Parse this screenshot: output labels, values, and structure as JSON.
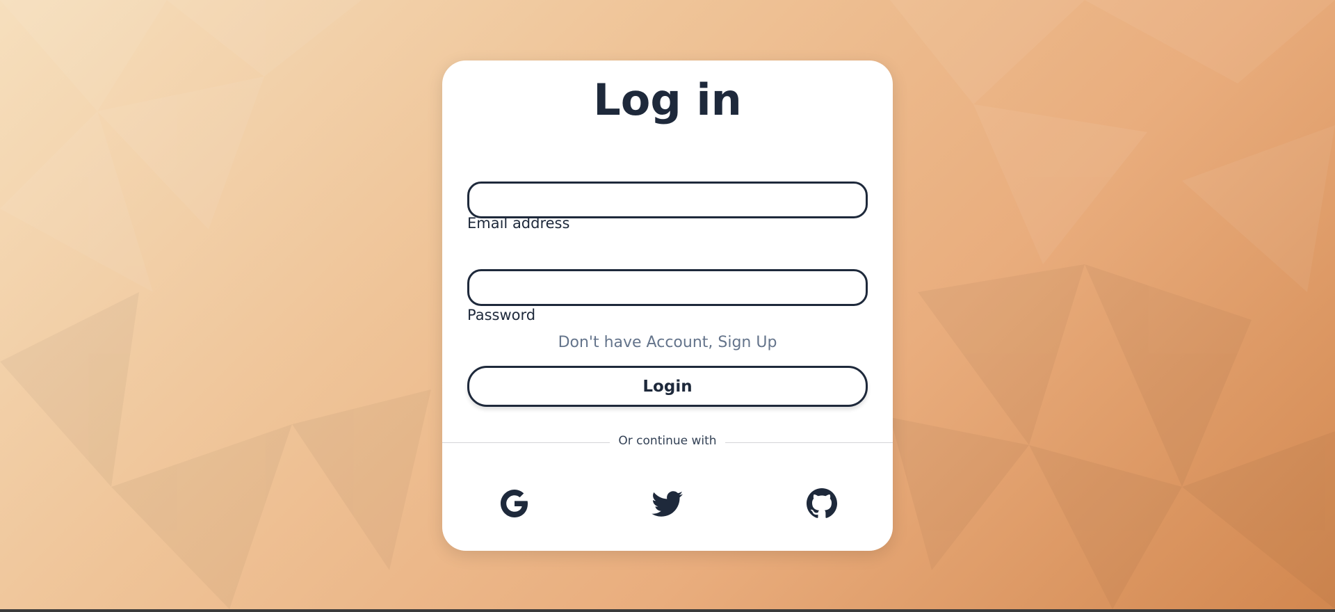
{
  "page": {
    "title": "Log in"
  },
  "form": {
    "email_label": "Email address",
    "email_value": "",
    "password_label": "Password",
    "password_value": "",
    "signup_link": "Don't have Account, Sign Up",
    "login_button": "Login"
  },
  "social": {
    "divider_text": "Or continue with",
    "providers": [
      {
        "name": "Google",
        "icon": "google-icon"
      },
      {
        "name": "Twitter",
        "icon": "twitter-icon"
      },
      {
        "name": "GitHub",
        "icon": "github-icon"
      }
    ]
  },
  "colors": {
    "text": "#1e293b",
    "muted": "#64748b",
    "card": "#ffffff",
    "background_start": "#f6dfbd",
    "background_end": "#d2874f"
  }
}
